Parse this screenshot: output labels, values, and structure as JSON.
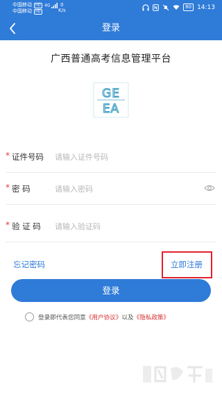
{
  "status_bar": {
    "carrier_1": "中国移动",
    "carrier_2": "中国移动",
    "hd_badge": "HD",
    "signal_label": "4G",
    "net_speed_value": "0",
    "net_speed_unit": "K/s",
    "battery": "80",
    "time": "14:13"
  },
  "nav": {
    "title": "登录"
  },
  "app": {
    "title": "广西普通高考信息管理平台",
    "logo_text": [
      "GE",
      "EA"
    ]
  },
  "form": {
    "id_label": "证件号码",
    "id_placeholder": "请输入证件号码",
    "password_label": "密 码",
    "password_placeholder": "请输入密码",
    "captcha_label": "验 证 码",
    "captcha_placeholder": "请输入验证码"
  },
  "links": {
    "forgot_password": "忘记密码",
    "register": "立即注册"
  },
  "login_button": "登录",
  "agreement": {
    "prefix": "登录即代表您同意",
    "user_agreement": "《用户协议》",
    "and": "以及",
    "privacy_policy": "《隐私政策》"
  },
  "colors": {
    "primary": "#2f7bd8",
    "required": "#e53935",
    "highlight_border": "#e0212b",
    "policy_link": "#d62f2f"
  }
}
